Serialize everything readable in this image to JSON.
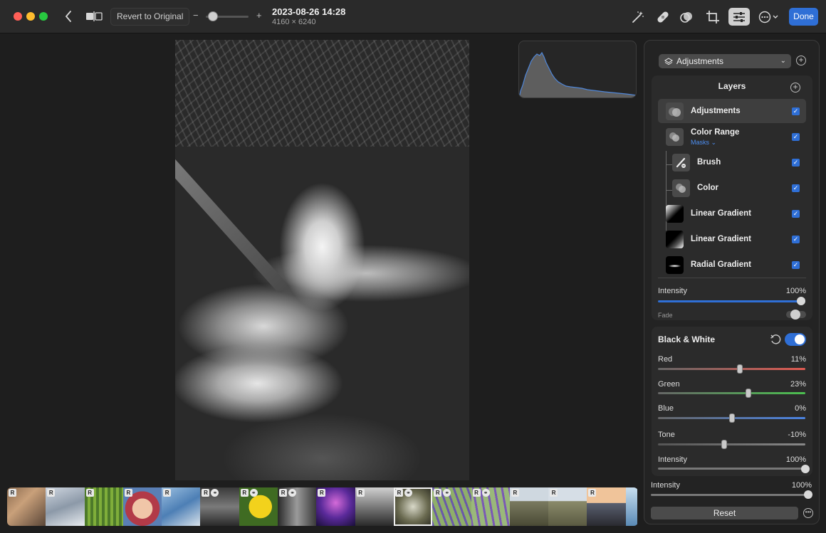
{
  "titlebar": {
    "revert_label": "Revert to Original",
    "zoom_minus": "−",
    "zoom_plus": "+",
    "zoom_level": 0.12,
    "photo_title": "2023-08-26 14:28",
    "photo_dimensions": "4160 × 6240",
    "done_label": "Done",
    "tools": [
      "enhance-icon",
      "retouch-icon",
      "filters-icon",
      "crop-icon",
      "adjust-icon",
      "more-icon"
    ]
  },
  "sidebar": {
    "adjustment_select": "Adjustments",
    "layers": {
      "title": "Layers",
      "items": [
        {
          "name": "Adjustments",
          "sub": "",
          "checked": true
        },
        {
          "name": "Color Range",
          "sub": "Masks ⌄",
          "checked": true
        },
        {
          "name": "Brush",
          "sub": "",
          "checked": true
        },
        {
          "name": "Color",
          "sub": "",
          "checked": true
        },
        {
          "name": "Linear Gradient",
          "sub": "",
          "checked": true
        },
        {
          "name": "Linear Gradient",
          "sub": "",
          "checked": true
        },
        {
          "name": "Radial Gradient",
          "sub": "",
          "checked": true
        }
      ],
      "intensity_label": "Intensity",
      "intensity_value": "100%",
      "fade_label": "Fade"
    },
    "black_white": {
      "title": "Black & White",
      "enabled": true,
      "sliders": [
        {
          "label": "Red",
          "value": "11%",
          "level": 0.555
        },
        {
          "label": "Green",
          "value": "23%",
          "level": 0.615
        },
        {
          "label": "Blue",
          "value": "0%",
          "level": 0.5
        },
        {
          "label": "Tone",
          "value": "-10%",
          "level": 0.45
        },
        {
          "label": "Intensity",
          "value": "100%",
          "level": 1.0
        }
      ]
    },
    "global_intensity_label": "Intensity",
    "global_intensity_value": "100%",
    "reset_label": "Reset"
  },
  "filmstrip": {
    "badge": "R",
    "items": [
      {
        "badge": true,
        "link": false
      },
      {
        "badge": true,
        "link": false
      },
      {
        "badge": true,
        "link": false
      },
      {
        "badge": true,
        "link": false
      },
      {
        "badge": true,
        "link": false
      },
      {
        "badge": true,
        "link": true
      },
      {
        "badge": true,
        "link": true
      },
      {
        "badge": true,
        "link": true
      },
      {
        "badge": true,
        "link": false
      },
      {
        "badge": true,
        "link": false
      },
      {
        "badge": true,
        "link": true,
        "selected": true
      },
      {
        "badge": true,
        "link": true
      },
      {
        "badge": true,
        "link": true
      },
      {
        "badge": true,
        "link": false
      },
      {
        "badge": true,
        "link": false
      },
      {
        "badge": true,
        "link": false
      },
      {
        "badge": false,
        "link": false
      }
    ]
  }
}
